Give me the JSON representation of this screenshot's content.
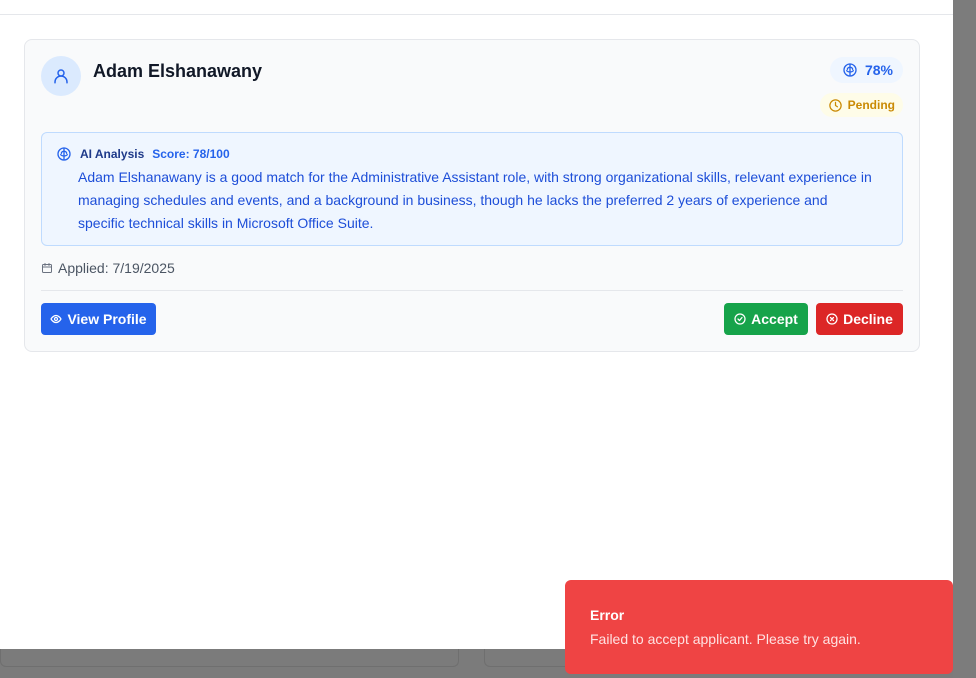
{
  "applicant": {
    "name": "Adam Elshanawany",
    "match_score": "78%",
    "status": "Pending",
    "ai_analysis": {
      "title": "AI Analysis",
      "score": "Score: 78/100",
      "summary": "Adam Elshanawany is a good match for the Administrative Assistant role, with strong organizational skills, relevant experience in managing schedules and events, and a background in business, though he lacks the preferred 2 years of experience and specific technical skills in Microsoft Office Suite."
    },
    "applied": "Applied: 7/19/2025"
  },
  "actions": {
    "view_profile": "View Profile",
    "accept": "Accept",
    "decline": "Decline"
  },
  "toast": {
    "title": "Error",
    "message": "Failed to accept applicant. Please try again."
  },
  "icons": {
    "avatar": "user-icon",
    "score": "brain-icon",
    "status": "clock-icon",
    "applied": "calendar-icon",
    "view": "eye-icon",
    "accept": "check-circle-icon",
    "decline": "x-circle-icon"
  },
  "colors": {
    "primary": "#2563eb",
    "success": "#16a34a",
    "danger": "#dc2626",
    "toast": "#ef4444",
    "pending": "#ca8a04"
  }
}
